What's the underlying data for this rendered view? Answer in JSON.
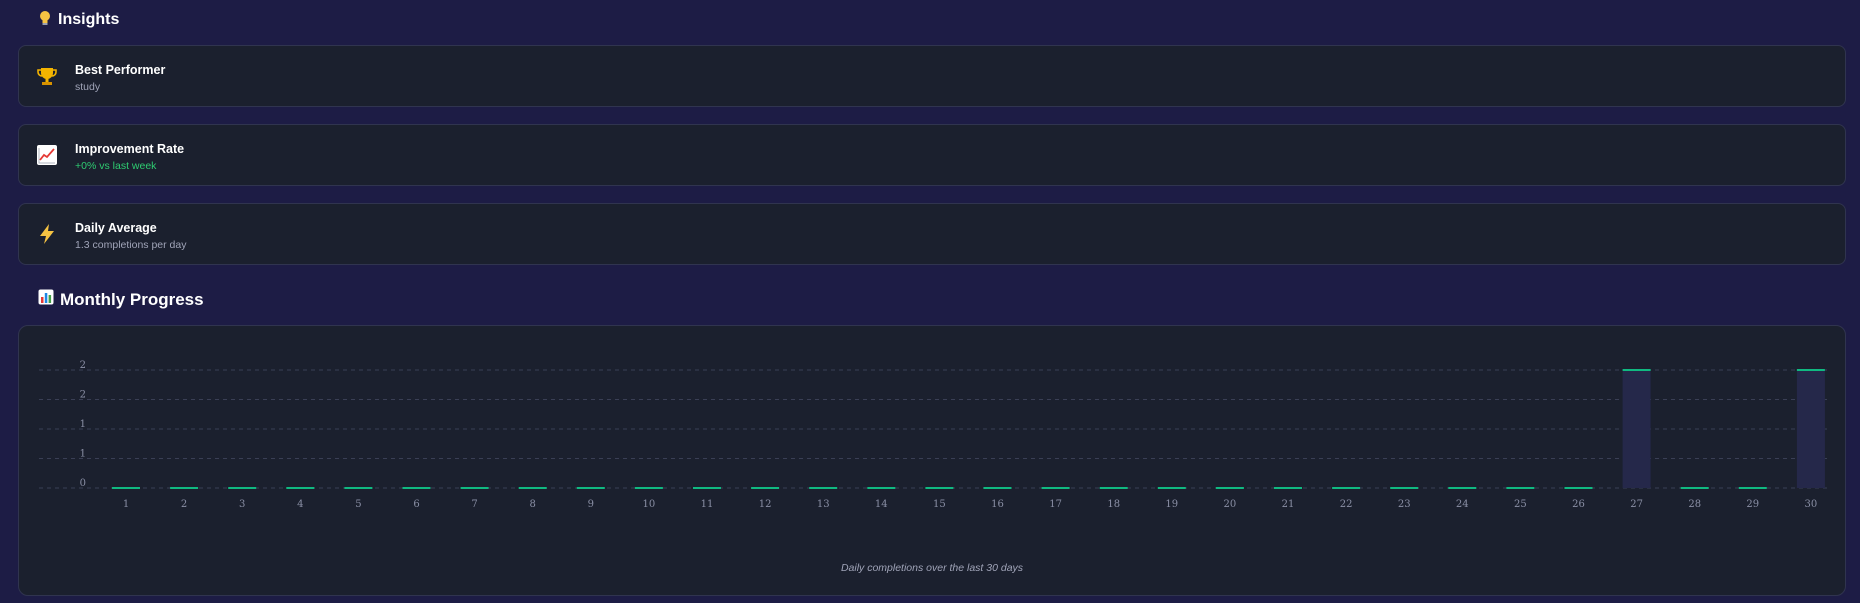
{
  "insights": {
    "title": "Insights",
    "icon": "lightbulb-icon",
    "cards": [
      {
        "icon": "trophy-icon",
        "title": "Best Performer",
        "subtitle": "study",
        "subtitle_color": "#a0a4b8"
      },
      {
        "icon": "chart-increasing-icon",
        "title": "Improvement Rate",
        "subtitle": "+0% vs last week",
        "subtitle_color": "#2ecc71"
      },
      {
        "icon": "lightning-icon",
        "title": "Daily Average",
        "subtitle": "1.3 completions per day",
        "subtitle_color": "#a0a4b8"
      }
    ]
  },
  "monthly": {
    "title": "Monthly Progress",
    "icon": "bar-chart-icon",
    "caption": "Daily completions over the last 30 days"
  },
  "chart_data": {
    "type": "bar",
    "categories": [
      "1",
      "2",
      "3",
      "4",
      "5",
      "6",
      "7",
      "8",
      "9",
      "10",
      "11",
      "12",
      "13",
      "14",
      "15",
      "16",
      "17",
      "18",
      "19",
      "20",
      "21",
      "22",
      "23",
      "24",
      "25",
      "26",
      "27",
      "28",
      "29",
      "30"
    ],
    "values": [
      0,
      0,
      0,
      0,
      0,
      0,
      0,
      0,
      0,
      0,
      0,
      0,
      0,
      0,
      0,
      0,
      0,
      0,
      0,
      0,
      0,
      0,
      0,
      0,
      0,
      0,
      2,
      0,
      0,
      2
    ],
    "y_tick_labels": [
      "0",
      "1",
      "1",
      "2",
      "2"
    ],
    "ylim": [
      0,
      2
    ],
    "grid": true,
    "colors": {
      "bar_fill": "#25284a",
      "bar_top": "#10b981",
      "grid": "#3a3f55"
    }
  }
}
